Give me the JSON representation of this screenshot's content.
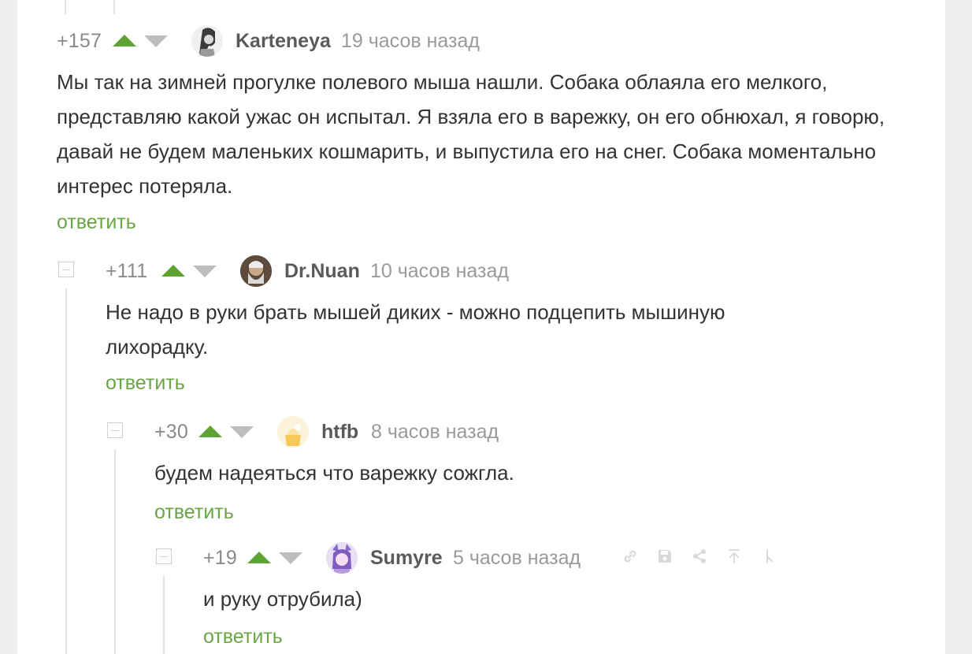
{
  "comments": [
    {
      "rating": "+157",
      "author": "Karteneya",
      "time": "19 часов назад",
      "text": "Мы так на зимней прогулке полевого мыша нашли. Собака облаяла его мелкого, представляю какой ужас он испытал. Я взяла его в варежку, он его обнюхал, я говорю, давай не будем маленьких кошмарить, и выпустила его на снег. Собака моментально интерес потеряла.",
      "reply_label": "ответить"
    },
    {
      "rating": "+111",
      "author": "Dr.Nuan",
      "time": "10 часов назад",
      "text": "Не надо в руки брать мышей диких - можно подцепить мышиную лихорадку.",
      "reply_label": "ответить"
    },
    {
      "rating": "+30",
      "author": "htfb",
      "time": "8 часов назад",
      "text": "будем надеяться что варежку сожгла.",
      "reply_label": "ответить"
    },
    {
      "rating": "+19",
      "author": "Sumyre",
      "time": "5 часов назад",
      "text": "и руку отрубила)",
      "reply_label": "ответить"
    }
  ],
  "colors": {
    "upvote": "#5ea234",
    "downvote": "#bdbdbd",
    "reply_link": "#6aa544",
    "author": "#5a5a5a",
    "meta": "#9a9a9a"
  },
  "toolbar_icons": [
    "link-icon",
    "save-icon",
    "share-icon",
    "scroll-up-icon",
    "branch-icon"
  ]
}
